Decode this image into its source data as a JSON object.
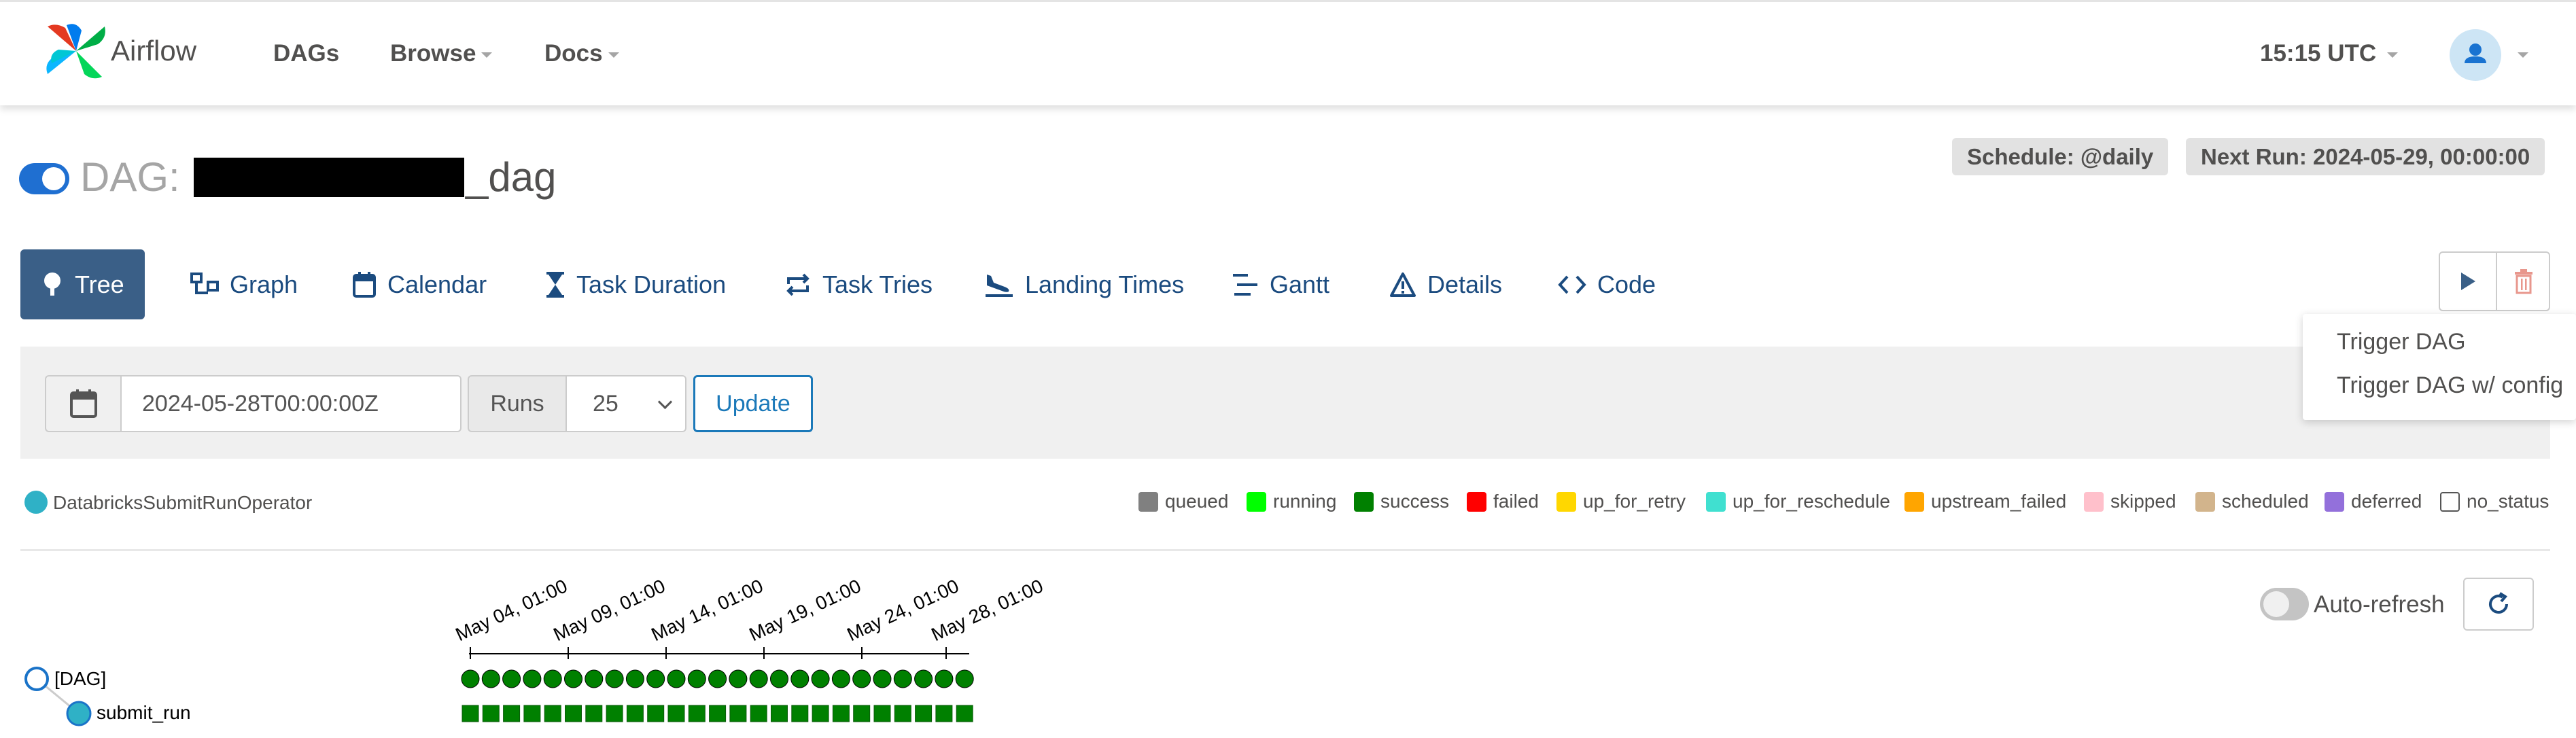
{
  "navbar": {
    "brand": "Airflow",
    "menu": [
      "DAGs",
      "Browse",
      "Docs"
    ],
    "clock": "15:15 UTC"
  },
  "dag": {
    "prefix": "DAG:",
    "name_suffix": "_dag",
    "schedule": "Schedule: @daily",
    "next_run": "Next Run: 2024-05-29, 00:00:00",
    "paused": false
  },
  "tabs": [
    {
      "label": "Tree",
      "icon": "tree-icon",
      "active": true
    },
    {
      "label": "Graph",
      "icon": "graph-icon"
    },
    {
      "label": "Calendar",
      "icon": "calendar-icon"
    },
    {
      "label": "Task Duration",
      "icon": "hourglass-icon"
    },
    {
      "label": "Task Tries",
      "icon": "repeat-icon"
    },
    {
      "label": "Landing Times",
      "icon": "plane-landing-icon"
    },
    {
      "label": "Gantt",
      "icon": "gantt-icon"
    },
    {
      "label": "Details",
      "icon": "warning-triangle-icon"
    },
    {
      "label": "Code",
      "icon": "code-icon"
    }
  ],
  "trigger_menu": [
    "Trigger DAG",
    "Trigger DAG w/ config"
  ],
  "filter": {
    "base_date": "2024-05-28T00:00:00Z",
    "runs_label": "Runs",
    "runs_value": "25",
    "update_label": "Update"
  },
  "operator": {
    "name": "DatabricksSubmitRunOperator",
    "color": "#2fb1c6"
  },
  "legend": [
    {
      "label": "queued",
      "color": "#808080"
    },
    {
      "label": "running",
      "color": "#00ff00"
    },
    {
      "label": "success",
      "color": "#008000"
    },
    {
      "label": "failed",
      "color": "#ff0000"
    },
    {
      "label": "up_for_retry",
      "color": "#ffd700"
    },
    {
      "label": "up_for_reschedule",
      "color": "#40e0d0"
    },
    {
      "label": "upstream_failed",
      "color": "#ffa500"
    },
    {
      "label": "skipped",
      "color": "#ffc0cb"
    },
    {
      "label": "scheduled",
      "color": "#d2b48c"
    },
    {
      "label": "deferred",
      "color": "#9370db"
    },
    {
      "label": "no_status",
      "color": "#ffffff"
    }
  ],
  "auto_refresh": {
    "label": "Auto-refresh",
    "enabled": false
  },
  "tree": {
    "date_labels": [
      "May 04, 01:00",
      "May 09, 01:00",
      "May 14, 01:00",
      "May 19, 01:00",
      "May 24, 01:00",
      "May 28, 01:00"
    ],
    "dag_node": "[DAG]",
    "task_node": "submit_run",
    "run_count": 25,
    "run_state": "success"
  }
}
